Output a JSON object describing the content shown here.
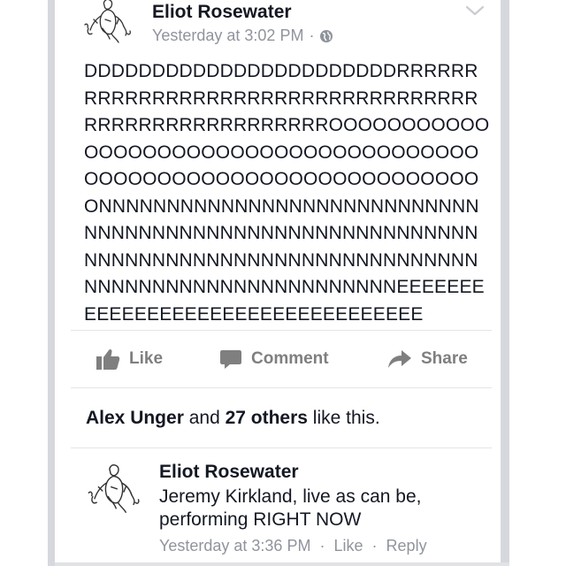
{
  "post": {
    "author": "Eliot Rosewater",
    "timestamp": "Yesterday at 3:02 PM",
    "separator": "·",
    "privacy_icon": "globe-icon",
    "menu_icon": "chevron-down-icon",
    "text": "DDDDDDDDDDDDDDDDDDDDDDDRRRRRRRRRRRRRRRRRRRRRRRRRRRRRRRRRRRRRRRRRRRRRRRRRRRRROOOOOOOOOOOOOOOOOOOOOOOOOOOOOOOOOOOOOOOOOOOOOOOOOOOOOOOOOOOOOOOOOONNNNNNNNNNNNNNNNNNNNNNNNNNNNNNNNNNNNNNNNNNNNNNNNNNNNNNNNNNNNNNNNNNNNNNNNNNNNNNNNNNNNNNNNNNNNNNNNNNNNNNNNNNNNNEEEEEEEEEEEEEEEEEEEEEEEEEEEEEEEEEE"
  },
  "actions": {
    "like": "Like",
    "comment": "Comment",
    "share": "Share"
  },
  "likes": {
    "name": "Alex Unger",
    "and": " and ",
    "count": "27 others",
    "suffix": " like this."
  },
  "comment": {
    "author": "Eliot Rosewater",
    "text": "Jeremy Kirkland, live as can be, performing RIGHT NOW",
    "timestamp": "Yesterday at 3:36 PM",
    "separator": "·",
    "like_label": "Like",
    "reply_label": "Reply"
  },
  "colors": {
    "text": "#141823",
    "meta": "#90949c",
    "action": "#7f7f7f",
    "sidebar": "#d6d8dd"
  }
}
